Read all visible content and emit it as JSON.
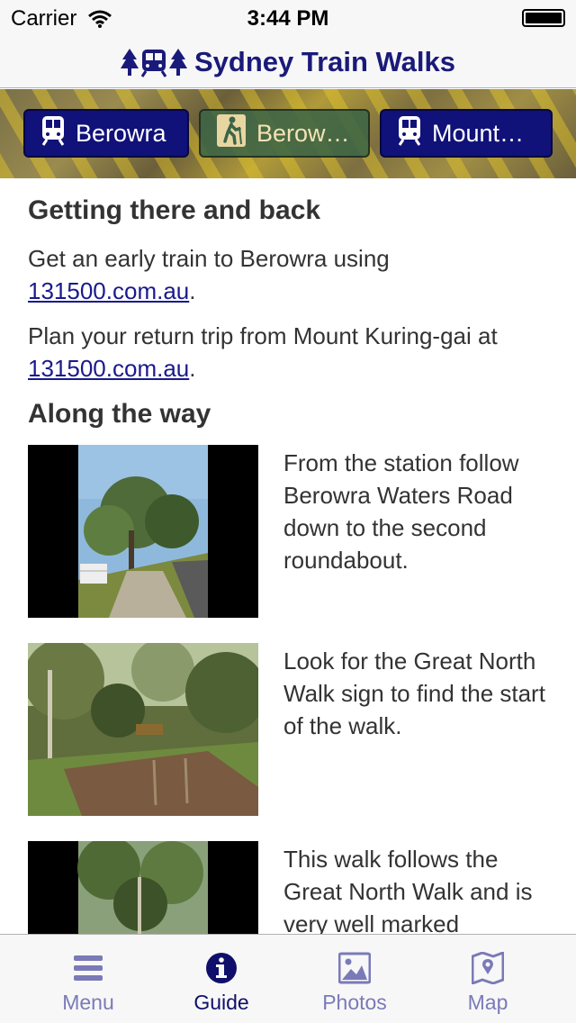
{
  "status_bar": {
    "carrier": "Carrier",
    "time": "3:44 PM"
  },
  "nav": {
    "title": "Sydney Train Walks"
  },
  "stations": [
    {
      "label": "Berowra",
      "icon": "train-icon"
    },
    {
      "label": "Berow…",
      "icon": "hiker-icon"
    },
    {
      "label": "Mount…",
      "icon": "train-icon"
    }
  ],
  "getting_there": {
    "heading": "Getting there and back",
    "para1_text": "Get an early train to Berowra using",
    "para1_link": "131500.com.au",
    "para2_text": "Plan your return trip from Mount Kuring-gai at",
    "para2_link": "131500.com.au",
    "period": "."
  },
  "along_the_way": {
    "heading": "Along the way",
    "steps": [
      {
        "text": "From the station follow Berowra Waters Road down to the second roundabout."
      },
      {
        "text": "Look for the Great North Walk sign to find the start of the walk."
      },
      {
        "text": "This walk follows the Great North Walk and is very well marked"
      }
    ]
  },
  "tabs": [
    {
      "label": "Menu",
      "icon": "menu-icon",
      "active": false
    },
    {
      "label": "Guide",
      "icon": "info-icon",
      "active": true
    },
    {
      "label": "Photos",
      "icon": "photos-icon",
      "active": false
    },
    {
      "label": "Map",
      "icon": "map-icon",
      "active": false
    }
  ],
  "colors": {
    "brand": "#1a1a7a",
    "tab_inactive": "#7a7ab8",
    "tab_active": "#0f0f6b",
    "link": "#1a1a8c"
  }
}
